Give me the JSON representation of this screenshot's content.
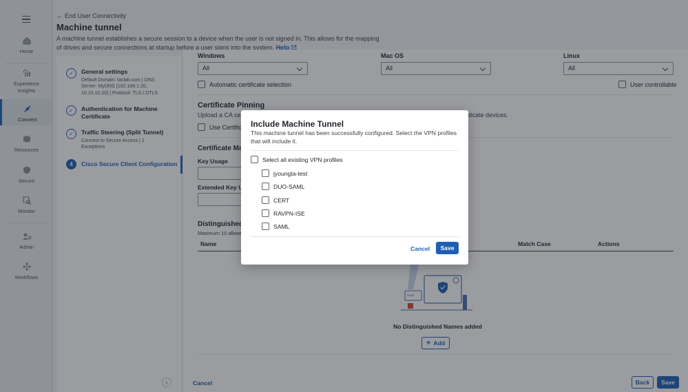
{
  "nav": {
    "items": [
      {
        "label": "Home",
        "icon": "home-icon"
      },
      {
        "label": "Experience Insights",
        "icon": "insights-icon"
      },
      {
        "label": "Connect",
        "icon": "connect-icon"
      },
      {
        "label": "Resources",
        "icon": "resources-icon"
      },
      {
        "label": "Secure",
        "icon": "shield-icon"
      },
      {
        "label": "Monitor",
        "icon": "monitor-icon"
      },
      {
        "label": "Admin",
        "icon": "admin-icon"
      },
      {
        "label": "Workflows",
        "icon": "workflows-icon"
      }
    ]
  },
  "header": {
    "back_label": "End User Connectivity",
    "title": "Machine tunnel",
    "description": "A machine tunnel establishes a secure session to a device when the user is not signed in. This allows for the mapping of drives and secure connections at startup before a user signs into the system.",
    "help_label": "Help"
  },
  "steps": [
    {
      "title": "General settings",
      "subtitle": "Default Domain: taclab.com | DNS Server: MyDNS (192.168.1.20, 10.10.10.20) | Protocol: TLS / DTLS",
      "marker": ""
    },
    {
      "title": "Authentication for Machine Certificate",
      "subtitle": "",
      "marker": ""
    },
    {
      "title": "Traffic Steering (Split Tunnel)",
      "subtitle": "Connect to Secure Access | 1 Exceptions",
      "marker": ""
    },
    {
      "title": "Cisco Secure Client Configuration",
      "subtitle": "",
      "marker": "4"
    }
  ],
  "main": {
    "os_columns": [
      {
        "label": "Windows",
        "value": "All"
      },
      {
        "label": "Mac OS",
        "value": "All"
      },
      {
        "label": "Linux",
        "value": "All"
      }
    ],
    "auto_cert_label": "Automatic certificate selection",
    "user_controllable_label": "User controllable",
    "cert_pinning_title": "Certificate Pinning",
    "cert_pinning_text_left": "Upload a CA certi",
    "cert_pinning_text_right": "nticate devices.",
    "use_cert_label": "Use Certific",
    "cert_match_title": "Certificate Ma",
    "key_usage_label": "Key Usage",
    "ext_key_usage_label": "Extended Key Us",
    "dn_title": "Distinguished",
    "dn_max": "Maximum 10 allowe",
    "table_headers": {
      "name": "Name",
      "match_case": "Match Case",
      "actions": "Actions"
    },
    "empty_text": "No Distinguished Names added",
    "add_label": "Add",
    "cancel_label": "Cancel",
    "back_label": "Back",
    "save_label": "Save"
  },
  "modal": {
    "title": "Include Machine Tunnel",
    "description": "This machine tunnel has been successfully configured. Select the VPN profiles that will include it.",
    "select_all_label": "Select all existing VPN profiles",
    "profiles": [
      "jyoungta-test",
      "DUO-SAML",
      "CERT",
      "RAVPN-ISE",
      "SAML"
    ],
    "cancel_label": "Cancel",
    "save_label": "Save"
  },
  "colors": {
    "accent": "#1f5fb3",
    "overlay": "rgba(30,35,45,0.45)"
  }
}
